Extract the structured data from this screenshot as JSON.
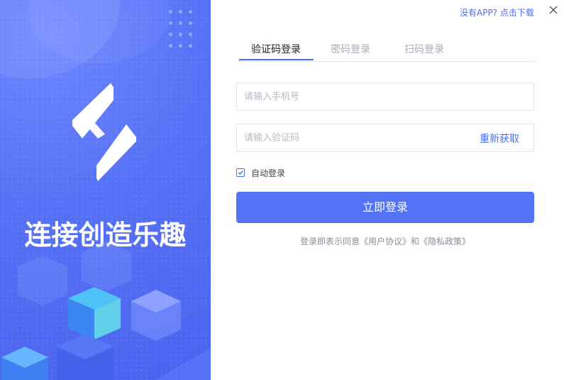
{
  "header": {
    "download_link": "没有APP? 点击下载"
  },
  "left_panel": {
    "slogan": "连接创造乐趣"
  },
  "tabs": [
    {
      "label": "验证码登录",
      "active": true
    },
    {
      "label": "密码登录",
      "active": false
    },
    {
      "label": "扫码登录",
      "active": false
    }
  ],
  "form": {
    "phone_placeholder": "请输入手机号",
    "phone_value": "",
    "code_placeholder": "请输入验证码",
    "code_value": "",
    "resend_label": "重新获取",
    "remember_label": "自动登录",
    "remember_checked": true,
    "submit_label": "立即登录"
  },
  "agreement": {
    "prefix": "登录即表示同意",
    "user_agreement": "《用户协议》",
    "conjunction": "和",
    "privacy_policy": "《隐私政策》"
  },
  "colors": {
    "accent": "#4a6cf0",
    "button": "#5373f4",
    "panel": "#5571f5"
  },
  "icons": {
    "close": "close-icon",
    "logo": "brand-logo",
    "check": "check-icon"
  }
}
